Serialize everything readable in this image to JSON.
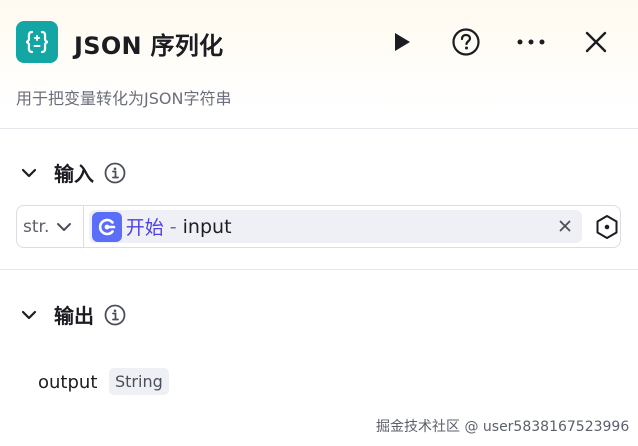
{
  "node": {
    "title": "JSON 序列化",
    "description": "用于把变量转化为JSON字符串",
    "icon": "json-braces-icon",
    "accent_color": "#14a6a4"
  },
  "toolbar": {
    "run_icon": "play-icon",
    "help_icon": "help-icon",
    "more_icon": "more-dots-icon",
    "close_icon": "close-icon"
  },
  "input_section": {
    "title": "输入",
    "param": {
      "type": "str.",
      "ref_node": "开始",
      "separator": "-",
      "ref_var": "input",
      "ref_color": "#5b6ef7"
    }
  },
  "output_section": {
    "title": "输出",
    "output": {
      "name": "output",
      "type": "String"
    }
  },
  "watermark": "掘金技术社区 @ user5838167523996"
}
